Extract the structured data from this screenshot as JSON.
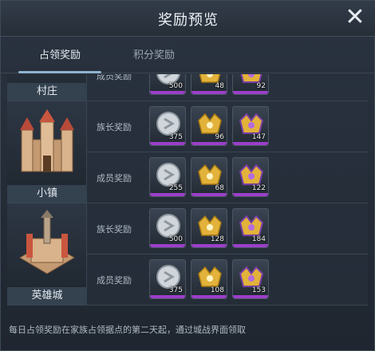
{
  "window": {
    "title": "奖励预览",
    "close_icon": "close-icon"
  },
  "tabs": [
    {
      "label": "占领奖励",
      "active": true
    },
    {
      "label": "积分奖励",
      "active": false
    }
  ],
  "cities": [
    {
      "name": "村庄",
      "rows": [
        {
          "label": "成员奖励",
          "rewards": [
            {
              "icon": "silver-coin-icon",
              "count": "500"
            },
            {
              "icon": "gold-crown-icon",
              "count": "48"
            },
            {
              "icon": "gold-crown-purple-icon",
              "count": "92"
            }
          ]
        }
      ]
    },
    {
      "name": "小镇",
      "rows": [
        {
          "label": "族长奖励",
          "rewards": [
            {
              "icon": "silver-coin-icon",
              "count": "375"
            },
            {
              "icon": "gold-crown-icon",
              "count": "96"
            },
            {
              "icon": "gold-crown-purple-icon",
              "count": "147"
            }
          ]
        },
        {
          "label": "成员奖励",
          "rewards": [
            {
              "icon": "silver-coin-icon",
              "count": "255"
            },
            {
              "icon": "gold-crown-icon",
              "count": "68"
            },
            {
              "icon": "gold-crown-purple-icon",
              "count": "122"
            }
          ]
        }
      ]
    },
    {
      "name": "英雄城",
      "rows": [
        {
          "label": "族长奖励",
          "rewards": [
            {
              "icon": "silver-coin-icon",
              "count": "500"
            },
            {
              "icon": "gold-crown-icon",
              "count": "128"
            },
            {
              "icon": "gold-crown-purple-icon",
              "count": "184"
            }
          ]
        },
        {
          "label": "成员奖励",
          "rewards": [
            {
              "icon": "silver-coin-icon",
              "count": "375"
            },
            {
              "icon": "gold-crown-icon",
              "count": "108"
            },
            {
              "icon": "gold-crown-purple-icon",
              "count": "153"
            }
          ]
        }
      ]
    }
  ],
  "footer": {
    "text": "每日占领奖励在家族占领据点的第二天起，通过城战界面领取"
  },
  "colors": {
    "accent_tab": "#8fb4cf",
    "rarity_purple": "#9b3fc9",
    "gold": "#e2b23a",
    "silver": "#cfd5db"
  }
}
